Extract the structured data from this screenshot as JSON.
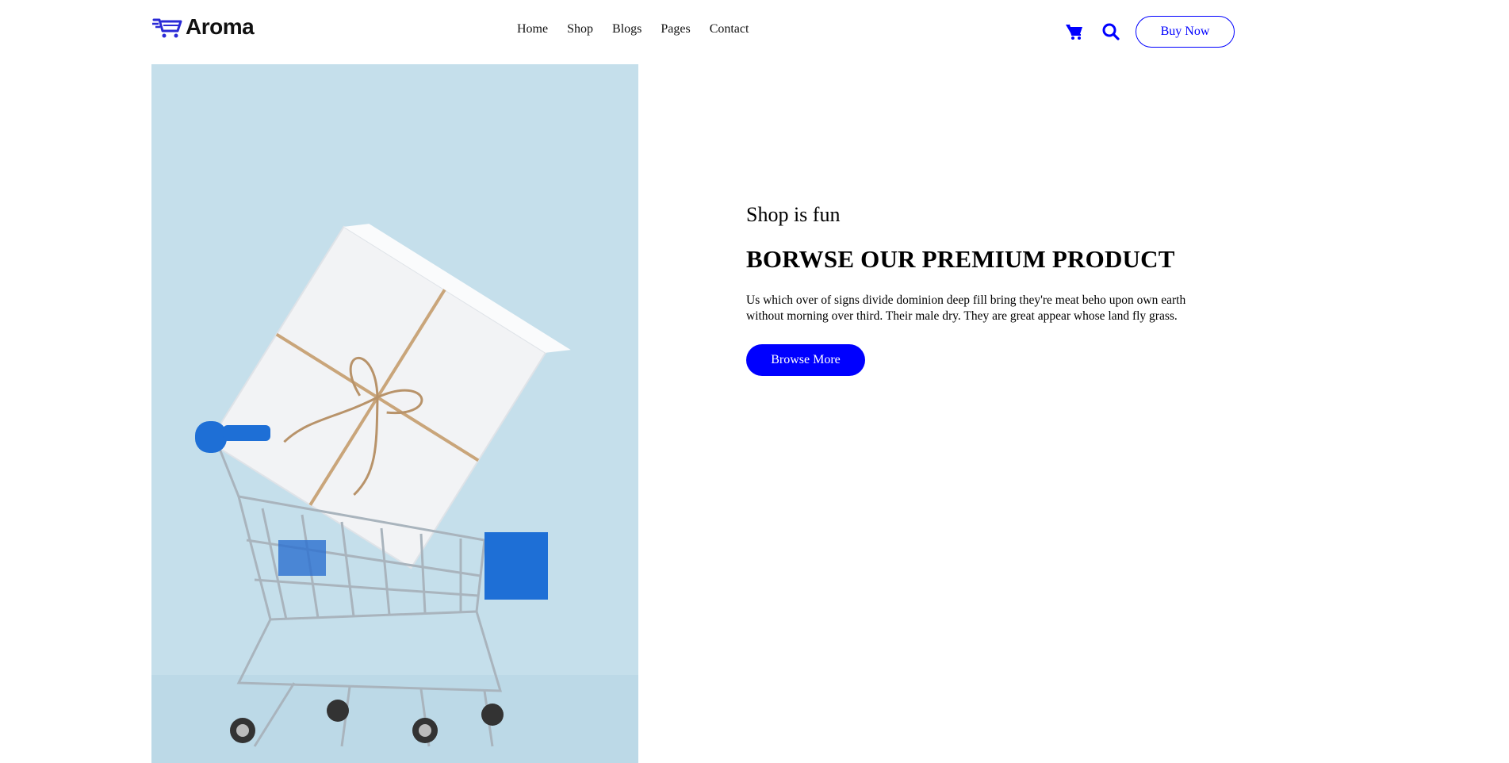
{
  "brand": {
    "name": "Aroma",
    "accent_color": "#0000ff",
    "logo_icon": "shopping-cart-lines-icon"
  },
  "nav": {
    "items": [
      {
        "label": "Home"
      },
      {
        "label": "Shop"
      },
      {
        "label": "Blogs"
      },
      {
        "label": "Pages"
      },
      {
        "label": "Contact"
      }
    ]
  },
  "header_actions": {
    "cart_icon": "shopping-cart-icon",
    "search_icon": "search-icon",
    "buy_now_label": "Buy Now"
  },
  "hero": {
    "image_description_icon": "shopping-cart-with-gift-image",
    "image_bg_color": "#c5dfeb",
    "subtitle": "Shop is fun",
    "title": "BORWSE OUR PREMIUM PRODUCT",
    "text": "Us which over of signs divide dominion deep fill bring they're meat beho upon own earth without morning over third. Their male dry. They are great appear whose land fly grass.",
    "button_label": "Browse More"
  }
}
